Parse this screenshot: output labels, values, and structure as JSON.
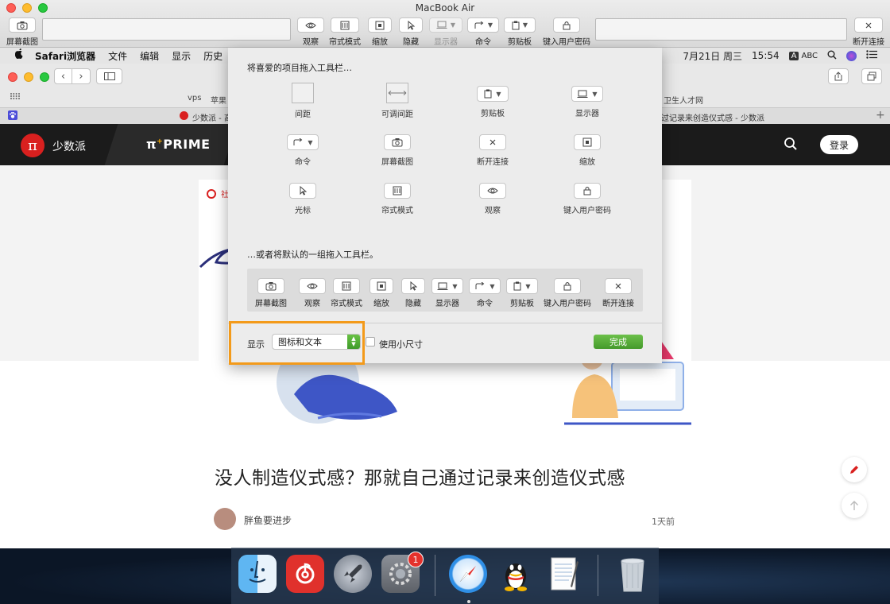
{
  "window": {
    "title": "MacBook Air",
    "toolbar_left": {
      "label": "屏幕截图",
      "icon": "camera-icon"
    },
    "toolbar_items": [
      {
        "label": "观察",
        "icon": "eye-icon"
      },
      {
        "label": "帘式模式",
        "icon": "curtain-icon"
      },
      {
        "label": "缩放",
        "icon": "zoom-icon"
      },
      {
        "label": "隐藏",
        "icon": "cursor-icon"
      },
      {
        "label": "显示器",
        "icon": "display-icon"
      },
      {
        "label": "命令",
        "icon": "command-icon"
      },
      {
        "label": "剪贴板",
        "icon": "clipboard-icon"
      },
      {
        "label": "键入用户密码",
        "icon": "lock-icon"
      }
    ],
    "toolbar_right": {
      "label": "断开连接",
      "icon": "close-icon"
    }
  },
  "menubar": {
    "app": "Safari浏览器",
    "items": [
      "文件",
      "编辑",
      "显示",
      "历史"
    ],
    "date": "7月21日 周三",
    "time": "15:54",
    "input_badge": "A",
    "input_method": "ABC"
  },
  "safari": {
    "bookmarks": {
      "left1": "vps",
      "left2": "苹果",
      "right": "卫生人才网"
    },
    "tabs": {
      "left": "少数派 - 高",
      "right": "过记录来创造仪式感 - 少数派"
    }
  },
  "site": {
    "logo_text": "少数派",
    "prime": "PRIME",
    "prime_sup": "+",
    "login": "登录"
  },
  "article": {
    "title": "没人制造仪式感？那就自己通过记录来创造仪式感",
    "author": "胖鱼要进步",
    "time": "1天前"
  },
  "sheet": {
    "heading": "将喜爱的项目拖入工具栏…",
    "palette": [
      {
        "label": "间距",
        "icon": "space-icon"
      },
      {
        "label": "可调间距",
        "icon": "flexible-space-icon"
      },
      {
        "label": "剪贴板",
        "icon": "clipboard-icon"
      },
      {
        "label": "显示器",
        "icon": "display-icon"
      },
      {
        "label": "命令",
        "icon": "command-icon"
      },
      {
        "label": "屏幕截图",
        "icon": "camera-icon"
      },
      {
        "label": "断开连接",
        "icon": "close-icon"
      },
      {
        "label": "缩放",
        "icon": "zoom-icon"
      },
      {
        "label": "光标",
        "icon": "cursor-icon"
      },
      {
        "label": "帘式模式",
        "icon": "curtain-icon"
      },
      {
        "label": "观察",
        "icon": "eye-icon"
      },
      {
        "label": "键入用户密码",
        "icon": "lock-icon"
      }
    ],
    "default_heading": "…或者将默认的一组拖入工具栏。",
    "default_set": [
      {
        "label": "屏幕截图"
      },
      {
        "label": "观察"
      },
      {
        "label": "帘式模式"
      },
      {
        "label": "缩放"
      },
      {
        "label": "隐藏"
      },
      {
        "label": "显示器"
      },
      {
        "label": "命令"
      },
      {
        "label": "剪贴板"
      },
      {
        "label": "键入用户密码"
      },
      {
        "label": "断开连接"
      }
    ],
    "show_label": "显示",
    "show_value": "图标和文本",
    "small_size_label": "使用小尺寸",
    "small_size_checked": false,
    "done": "完成"
  },
  "dock": {
    "badge": "1",
    "apps": [
      "finder-icon",
      "netease-music-icon",
      "launchpad-icon",
      "system-preferences-icon",
      "safari-icon",
      "qq-icon",
      "textedit-icon",
      "trash-icon"
    ]
  },
  "colors": {
    "highlight": "#f39a1a",
    "done_green": "#4ea733",
    "brand_red": "#d9201f"
  }
}
